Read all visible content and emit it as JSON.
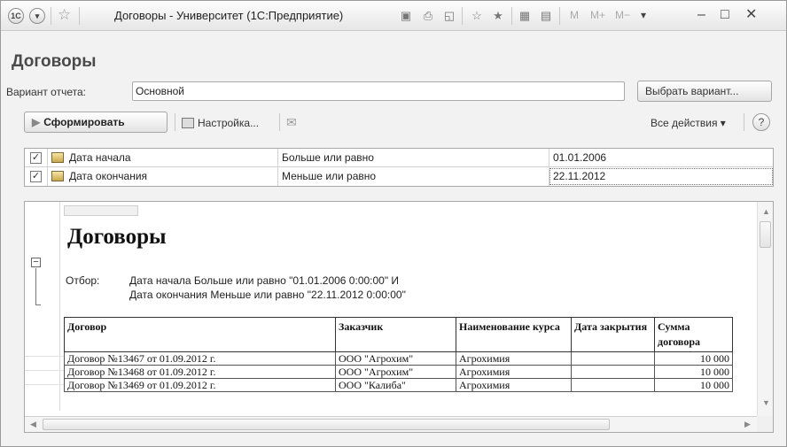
{
  "window": {
    "title": "Договоры - Университет  (1С:Предприятие)",
    "m_buttons": [
      "M",
      "M+",
      "M−"
    ]
  },
  "header": {
    "title": "Договоры",
    "variant_label": "Вариант отчета:",
    "variant_value": "Основной",
    "choose_variant_label": "Выбрать вариант..."
  },
  "toolbar": {
    "generate_label": "Сформировать",
    "settings_label": "Настройка...",
    "all_actions_label": "Все действия ▾",
    "help_label": "?"
  },
  "filters": [
    {
      "checked": true,
      "field": "Дата начала",
      "condition": "Больше или равно",
      "value": "01.01.2006"
    },
    {
      "checked": true,
      "field": "Дата окончания",
      "condition": "Меньше или равно",
      "value": "22.11.2012"
    }
  ],
  "report": {
    "title": "Договоры",
    "filter_label": "Отбор:",
    "filter_line1": "Дата начала Больше или равно \"01.01.2006 0:00:00\" И",
    "filter_line2": "Дата окончания Меньше или равно \"22.11.2012 0:00:00\"",
    "columns": [
      "Договор",
      "Заказчик",
      "Наименование курса",
      "Дата закрытия",
      "Сумма договора"
    ],
    "rows": [
      {
        "contract": "Договор №13467 от 01.09.2012 г.",
        "customer": "ООО \"Агрохим\"",
        "course": "Агрохимия",
        "close_date": "",
        "amount": "10 000"
      },
      {
        "contract": "Договор №13468 от 01.09.2012 г.",
        "customer": "ООО \"Агрохим\"",
        "course": "Агрохимия",
        "close_date": "",
        "amount": "10 000"
      },
      {
        "contract": "Договор №13469 от 01.09.2012 г.",
        "customer": "ООО \"Калиба\"",
        "course": "Агрохимия",
        "close_date": "",
        "amount": "10 000"
      }
    ]
  }
}
